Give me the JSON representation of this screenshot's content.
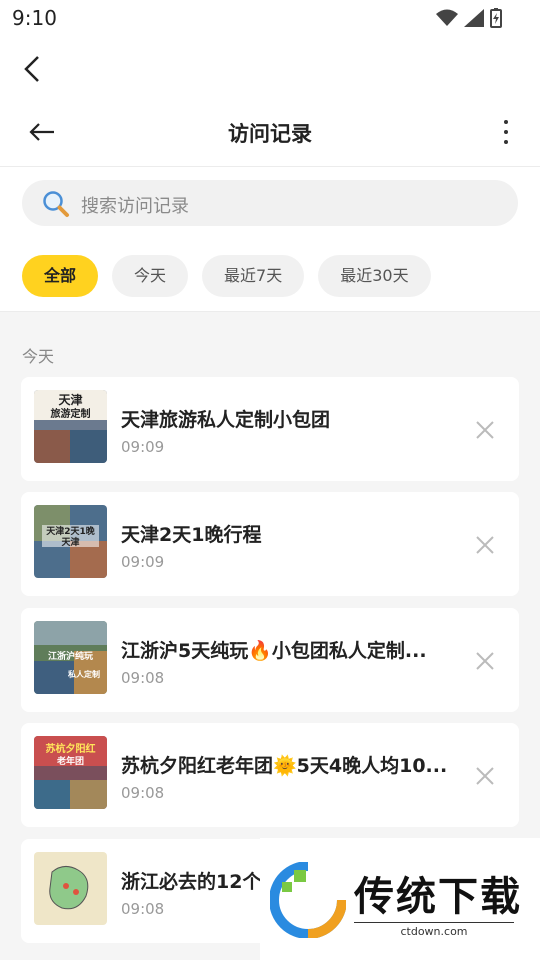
{
  "status_bar": {
    "time": "9:10",
    "icons": [
      "wifi-icon",
      "signal-icon",
      "battery-icon"
    ]
  },
  "header": {
    "title": "访问记录"
  },
  "search": {
    "placeholder": "搜索访问记录"
  },
  "filters": [
    {
      "label": "全部",
      "active": true
    },
    {
      "label": "今天",
      "active": false
    },
    {
      "label": "最近7天",
      "active": false
    },
    {
      "label": "最近30天",
      "active": false
    }
  ],
  "section_label": "今天",
  "records": [
    {
      "title": "天津旅游私人定制小包团",
      "time": "09:09"
    },
    {
      "title": "天津2天1晚行程",
      "time": "09:09"
    },
    {
      "title": "江浙沪5天纯玩🔥小包团私人定制...",
      "time": "09:08"
    },
    {
      "title": "苏杭夕阳红老年团🌞5天4晚人均10...",
      "time": "09:08"
    },
    {
      "title": "浙江必去的12个",
      "time": "09:08"
    }
  ],
  "thumbnails": [
    {
      "text_top": "天津",
      "text_bottom": "旅游定制"
    },
    {
      "text_top": "天津2天1晚",
      "text_bottom": "天津"
    },
    {
      "text_top": "江浙沪纯玩",
      "text_bottom": "私人定制"
    },
    {
      "text_top": "苏杭夕阳红",
      "text_bottom": "老年团"
    },
    {
      "text_top": "",
      "text_bottom": ""
    }
  ],
  "watermark": {
    "text": "传统下载",
    "url": "ctdown.com"
  },
  "colors": {
    "accent": "#ffd21f",
    "background": "#f5f5f5"
  }
}
